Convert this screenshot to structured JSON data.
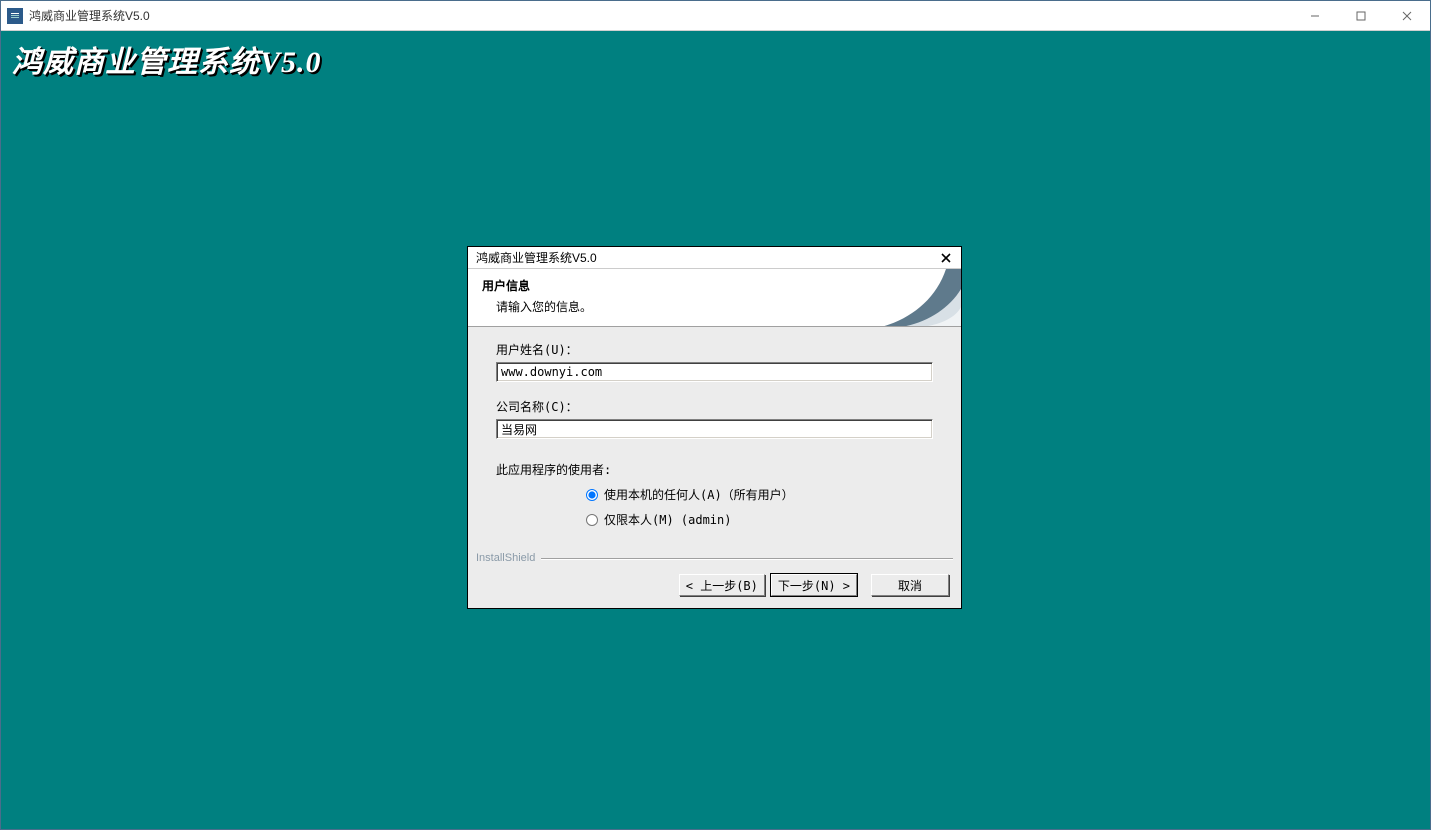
{
  "outer_window": {
    "title": "鸿威商业管理系统V5.0"
  },
  "banner": {
    "text": "鸿威商业管理系统V5.0"
  },
  "dialog": {
    "title": "鸿威商业管理系统V5.0",
    "header": {
      "title": "用户信息",
      "subtitle": "请输入您的信息。"
    },
    "form": {
      "username_label": "用户姓名(U)：",
      "username_value": "www.downyi.com",
      "company_label": "公司名称(C)：",
      "company_value": "当易网",
      "scope_label": "此应用程序的使用者:",
      "radio_all": "使用本机的任何人(A)（所有用户）",
      "radio_me": "仅限本人(M) (admin)"
    },
    "branding": "InstallShield",
    "buttons": {
      "back": "< 上一步(B)",
      "next": "下一步(N) >",
      "cancel": "取消"
    }
  }
}
